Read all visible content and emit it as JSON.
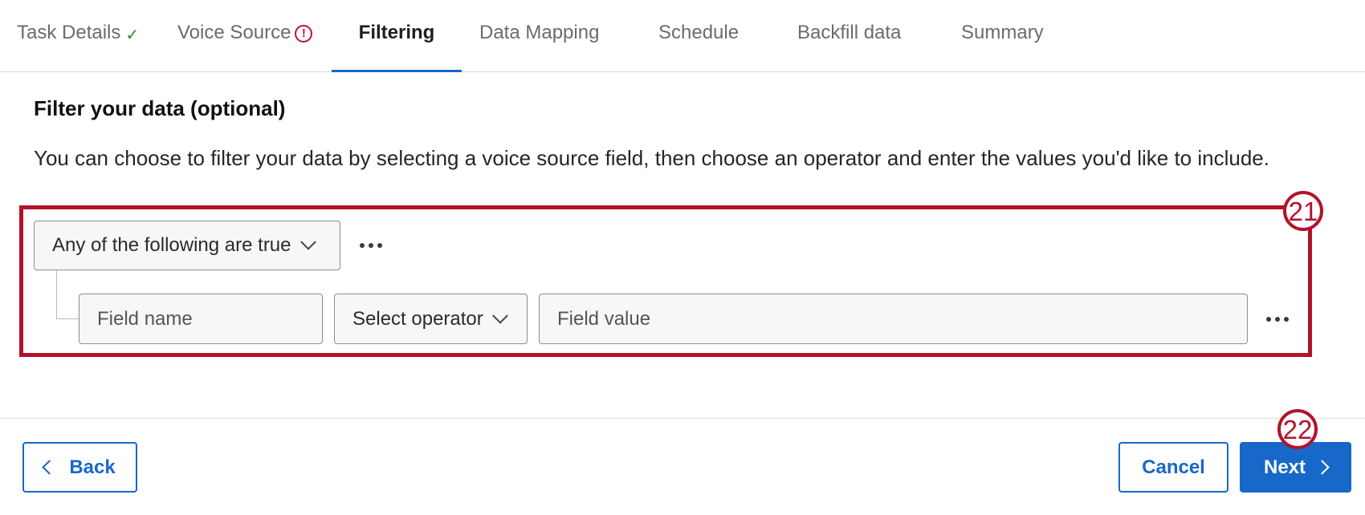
{
  "tabs": [
    {
      "label": "Task Details",
      "status": "complete",
      "status_icon": "checkmark-icon",
      "status_glyph": "✓"
    },
    {
      "label": "Voice Source",
      "status": "error",
      "status_icon": "error-icon",
      "status_glyph": "!"
    },
    {
      "label": "Filtering",
      "status": "active"
    },
    {
      "label": "Data Mapping"
    },
    {
      "label": "Schedule"
    },
    {
      "label": "Backfill data"
    },
    {
      "label": "Summary"
    }
  ],
  "main": {
    "title": "Filter your data (optional)",
    "description": "You can choose to filter your data by selecting a voice source field, then choose an operator and enter the values you'd like to include.",
    "condition_select": {
      "value": "Any of the following are true",
      "icon": "chevron-down-icon"
    },
    "more_options_icon": "more-horizontal-icon",
    "filter_row": {
      "field_name_placeholder": "Field name",
      "operator_value": "Select operator",
      "field_value_placeholder": "Field value"
    }
  },
  "annotations": {
    "badge_21": "21",
    "badge_22": "22"
  },
  "footer": {
    "back_label": "Back",
    "cancel_label": "Cancel",
    "next_label": "Next"
  },
  "colors": {
    "accent": "#1768c9",
    "annotation": "#b3122b",
    "success": "#2e8a3a",
    "error": "#c8102e"
  }
}
